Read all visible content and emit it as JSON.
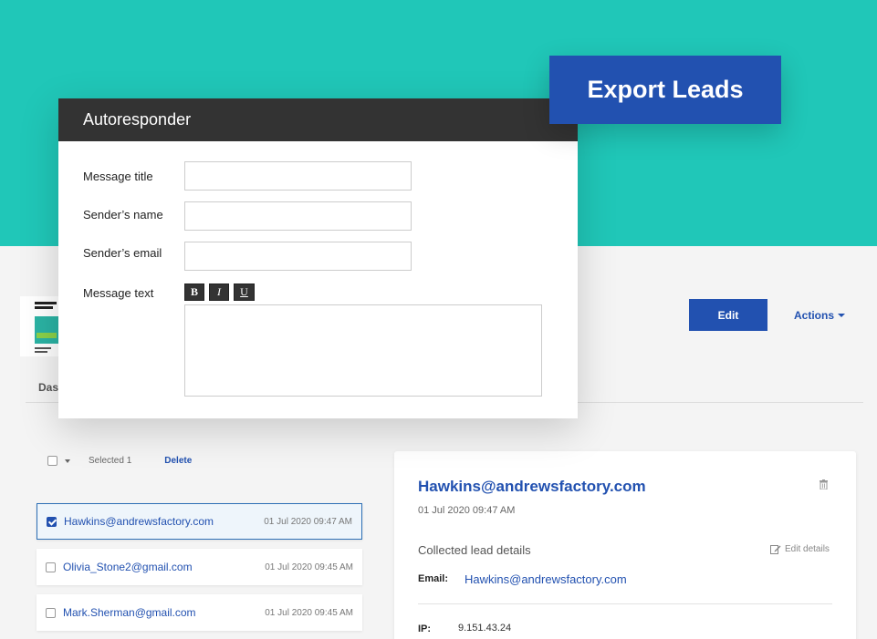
{
  "export_button": {
    "label": "Export Leads"
  },
  "modal": {
    "title": "Autoresponder",
    "fields": {
      "message_title": {
        "label": "Message title",
        "value": ""
      },
      "sender_name": {
        "label": "Sender’s name",
        "value": ""
      },
      "sender_email": {
        "label": "Sender’s email",
        "value": ""
      },
      "message_text": {
        "label": "Message text",
        "value": ""
      }
    },
    "format": {
      "bold": "B",
      "italic": "I",
      "underline": "U"
    }
  },
  "page": {
    "tab": "Das",
    "edit_label": "Edit",
    "actions_label": "Actions"
  },
  "bulk": {
    "selected": "Selected 1",
    "delete": "Delete"
  },
  "leads": [
    {
      "email": "Hawkins@andrewsfactory.com",
      "date": "01 Jul 2020 09:47 AM",
      "checked": true
    },
    {
      "email": "Olivia_Stone2@gmail.com",
      "date": "01 Jul 2020 09:45 AM",
      "checked": false
    },
    {
      "email": "Mark.Sherman@gmail.com",
      "date": "01 Jul 2020 09:45 AM",
      "checked": false
    }
  ],
  "detail": {
    "title": "Hawkins@andrewsfactory.com",
    "date": "01 Jul 2020 09:47 AM",
    "section": "Collected lead details",
    "edit_details": "Edit details",
    "email_label": "Email:",
    "email_value": "Hawkins@andrewsfactory.com",
    "ip_label": "IP:",
    "ip_value": "9.151.43.24"
  },
  "colors": {
    "teal": "#20c7b8",
    "brand_blue": "#2251b0",
    "modal_header": "#333333"
  }
}
